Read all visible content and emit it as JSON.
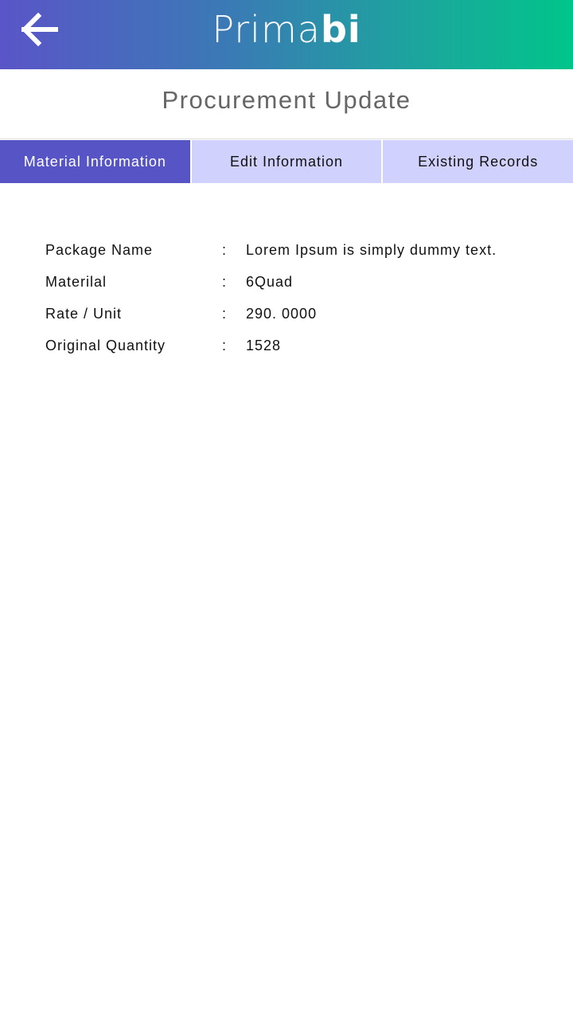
{
  "header": {
    "logo_text": "Primabi",
    "logo_main": "Prima",
    "logo_accent": "bi",
    "back_icon": "arrow-left-icon"
  },
  "page_title": "Procurement Update",
  "tabs": [
    {
      "label": "Material Information",
      "active": true
    },
    {
      "label": "Edit Information",
      "active": false
    },
    {
      "label": "Existing Records",
      "active": false
    }
  ],
  "fields": [
    {
      "label": "Package Name",
      "sep": ":",
      "value": "Lorem Ipsum is simply dummy text."
    },
    {
      "label": "Materilal",
      "sep": ":",
      "value": "6Quad"
    },
    {
      "label": "Rate / Unit",
      "sep": ":",
      "value": "290. 0000"
    },
    {
      "label": "Original Quantity",
      "sep": ":",
      "value": "1528"
    }
  ],
  "colors": {
    "active_tab": "#5755c5",
    "inactive_tab": "#d1d1fd",
    "gradient_start": "#5a55c8",
    "gradient_end": "#00c58a"
  }
}
